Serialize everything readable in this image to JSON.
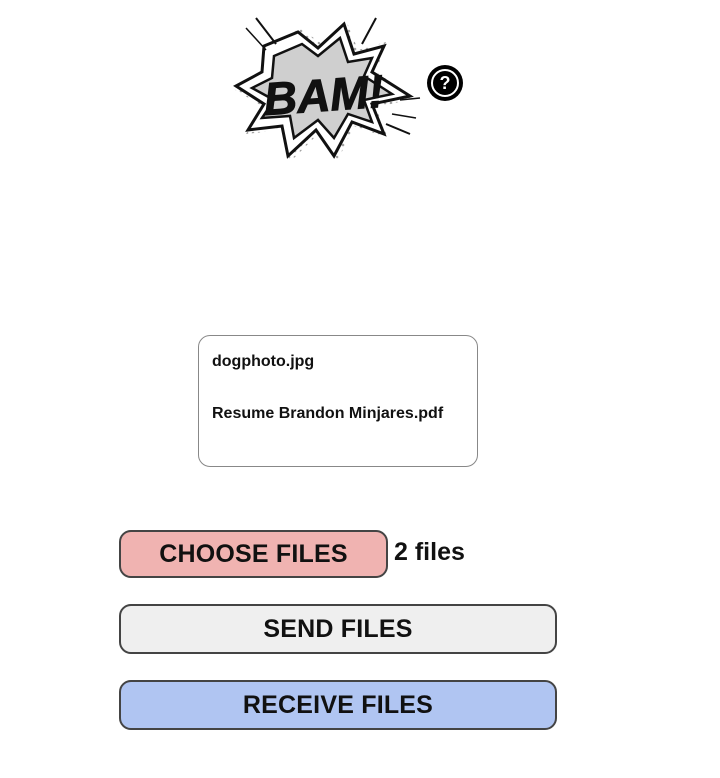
{
  "logo": {
    "text": "BAM!",
    "icon": "comic-burst-logo"
  },
  "help": {
    "icon": "question-mark-icon",
    "glyph": "?"
  },
  "file_list": {
    "items": [
      "dogphoto.jpg",
      "Resume Brandon Minjares.pdf"
    ]
  },
  "actions": {
    "choose_label": "CHOOSE FILES",
    "file_count": "2 files",
    "send_label": "SEND FILES",
    "receive_label": "RECEIVE FILES"
  },
  "colors": {
    "choose_bg": "#f0b3b1",
    "send_bg": "#efefef",
    "receive_bg": "#b0c5f2",
    "border": "#444444"
  }
}
